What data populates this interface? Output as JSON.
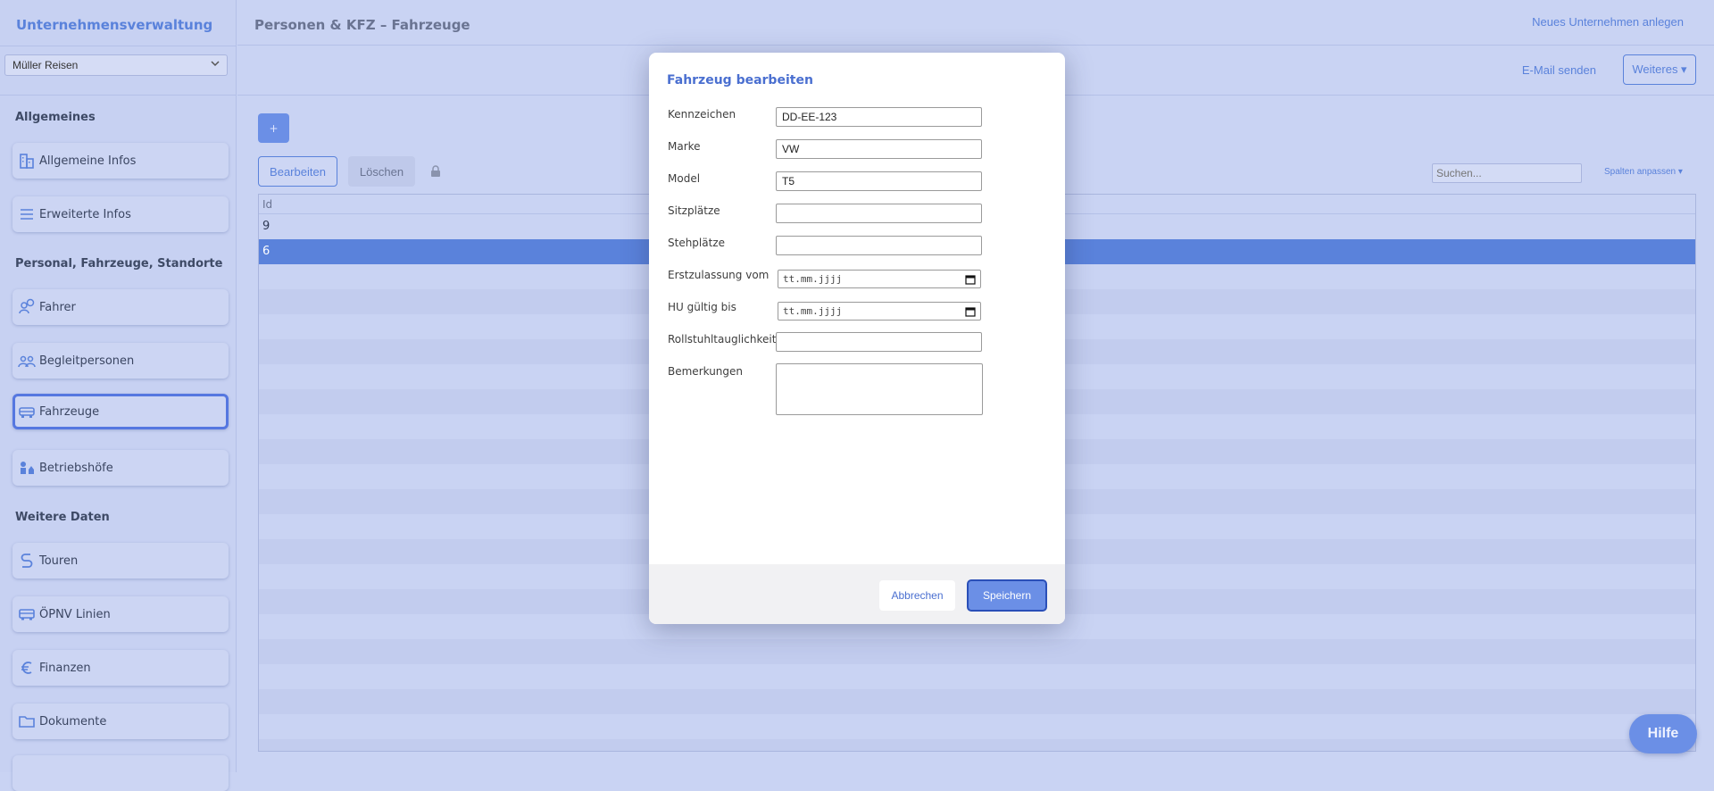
{
  "sidebar": {
    "title": "Unternehmensverwaltung",
    "company_select": "Müller Reisen",
    "sections": [
      {
        "heading": "Allgemeines",
        "items": [
          {
            "label": "Allgemeine Infos",
            "icon": "building-icon"
          },
          {
            "label": "Erweiterte Infos",
            "icon": "list-icon"
          }
        ]
      },
      {
        "heading": "Personal, Fahrzeuge, Standorte",
        "items": [
          {
            "label": "Fahrer",
            "icon": "driver-icon"
          },
          {
            "label": "Begleitpersonen",
            "icon": "people-icon"
          },
          {
            "label": "Fahrzeuge",
            "icon": "car-icon"
          },
          {
            "label": "Betriebshöfe",
            "icon": "depot-icon"
          }
        ]
      },
      {
        "heading": "Weitere Daten",
        "items": [
          {
            "label": "Touren",
            "icon": "route-icon"
          },
          {
            "label": "ÖPNV Linien",
            "icon": "bus-icon"
          },
          {
            "label": "Finanzen",
            "icon": "euro-icon"
          },
          {
            "label": "Dokumente",
            "icon": "folder-icon"
          }
        ]
      }
    ],
    "active_item": "Fahrzeuge"
  },
  "header": {
    "page_title": "Personen & KFZ – Fahrzeuge",
    "new_company": "Neues Unternehmen anlegen",
    "email": "E-Mail senden",
    "more": "Weiteres ▾"
  },
  "toolbar": {
    "add": "+",
    "edit": "Bearbeiten",
    "delete": "Löschen",
    "search_placeholder": "Suchen...",
    "columns": "Spalten anpassen ▾"
  },
  "grid": {
    "header": "Id",
    "rows": [
      "9",
      "6"
    ],
    "selected_index": 1
  },
  "modal": {
    "title": "Fahrzeug bearbeiten",
    "fields": {
      "kennzeichen": {
        "label": "Kennzeichen",
        "value": "DD-EE-123"
      },
      "marke": {
        "label": "Marke",
        "value": "VW"
      },
      "model": {
        "label": "Model",
        "value": "T5"
      },
      "sitzplaetze": {
        "label": "Sitzplätze",
        "value": ""
      },
      "stehplaetze": {
        "label": "Stehplätze",
        "value": ""
      },
      "erstzulassung": {
        "label": "Erstzulassung vom",
        "value": "tt.mm.jjjj"
      },
      "hu": {
        "label": "HU gültig bis",
        "value": "tt.mm.jjjj"
      },
      "rollstuhl": {
        "label": "Rollstuhltauglichkeit",
        "value": ""
      },
      "bemerkungen": {
        "label": "Bemerkungen",
        "value": ""
      }
    },
    "cancel": "Abbrechen",
    "save": "Speichern"
  },
  "help": "Hilfe",
  "colors": {
    "accent": "#5a82db",
    "selected_row": "#5a82db",
    "background": "#c9d3f3"
  }
}
